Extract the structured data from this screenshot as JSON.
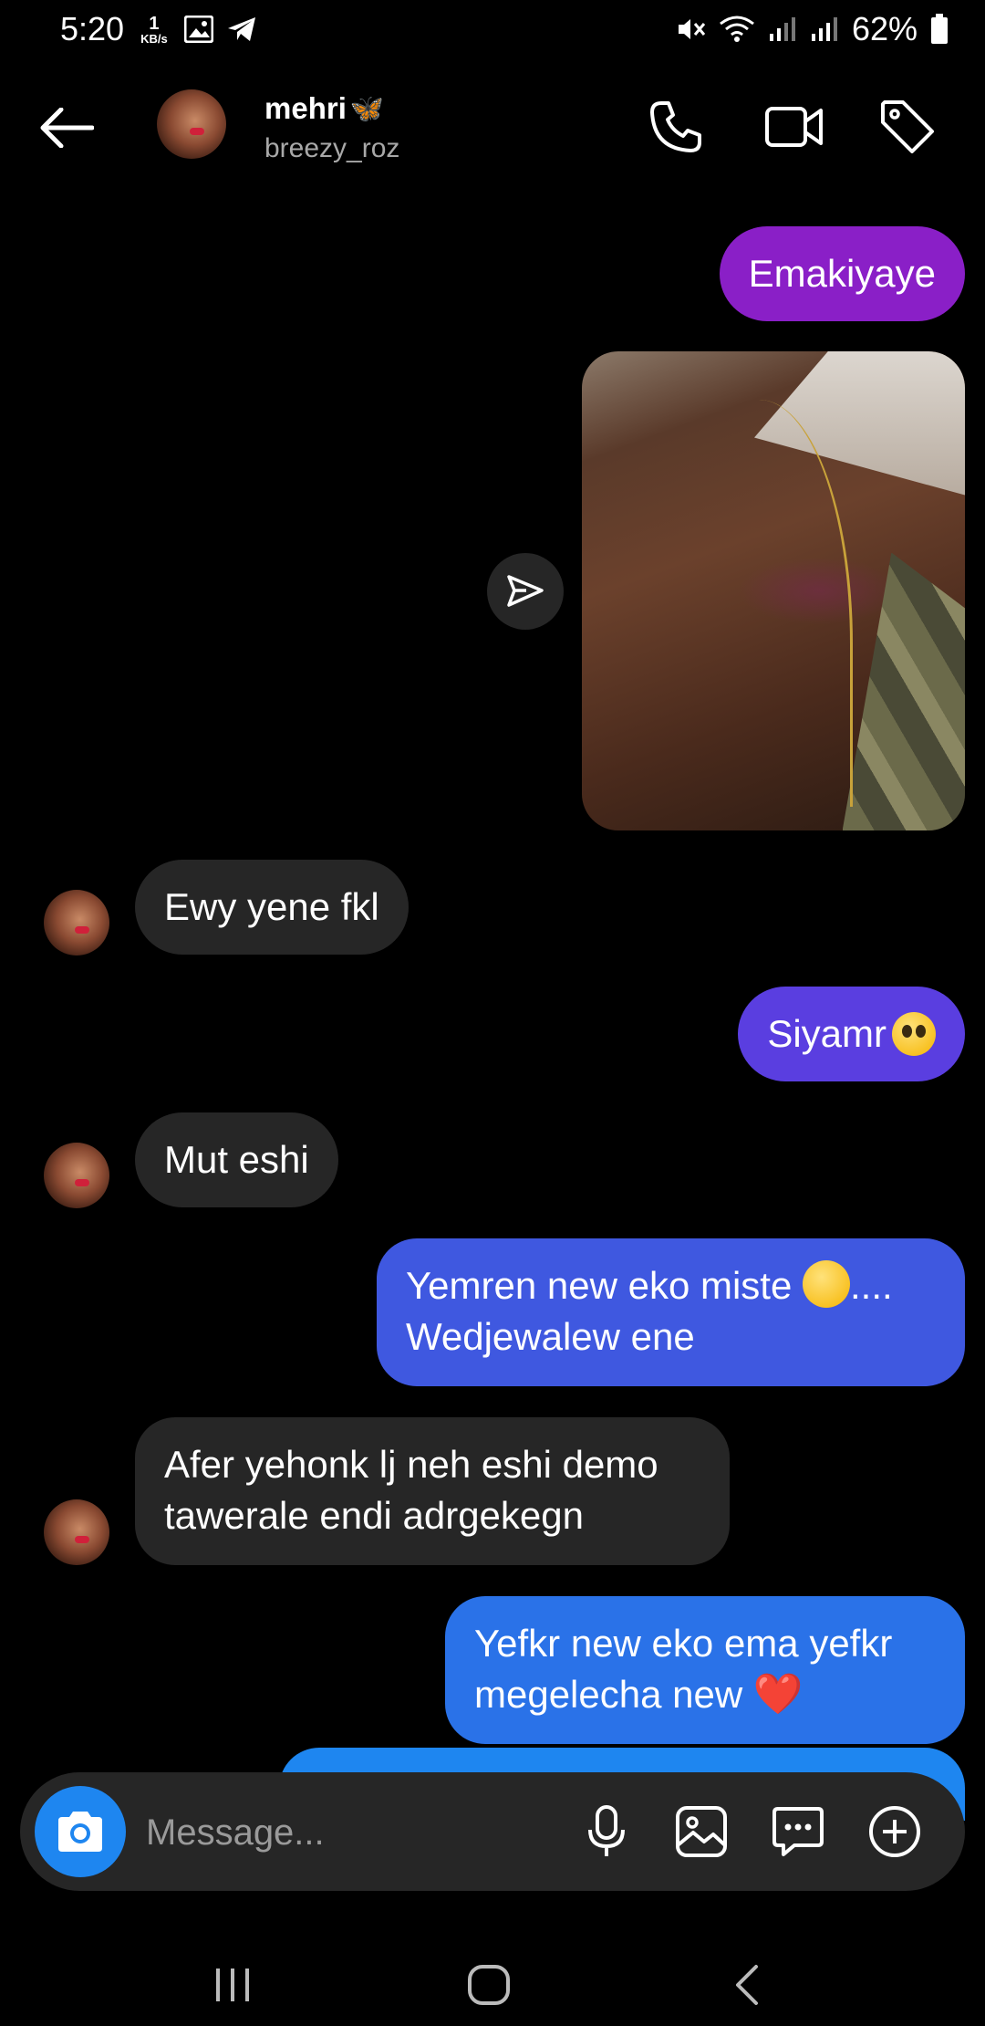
{
  "status_bar": {
    "time": "5:20",
    "data_rate_value": "1",
    "data_rate_unit": "KB/s",
    "battery": "62%"
  },
  "header": {
    "name": "mehri",
    "name_emoji": "🦋",
    "handle": "breezy_roz"
  },
  "messages": [
    {
      "from": "me",
      "text": "Emakiyaye",
      "color": "#8a1fc7"
    },
    {
      "from": "me",
      "type": "photo"
    },
    {
      "from": "them",
      "text": "Ewy yene fkl"
    },
    {
      "from": "me",
      "text": "Siyamr",
      "emoji": "pleading-face",
      "color": "#5a3ee0"
    },
    {
      "from": "them",
      "text": "Mut eshi"
    },
    {
      "from": "me",
      "line1": "Yemren new eko miste",
      "line1_suffix": "....",
      "line2": "Wedjewalew ene",
      "emoji": "hugging-face",
      "color": "#3f58e0"
    },
    {
      "from": "them",
      "line1": "Afer yehonk lj neh eshi demo",
      "line2": "tawerale endi adrgekegn"
    },
    {
      "from": "me",
      "line1": "Yefkr new eko ema yefkr",
      "line2": "megelecha new",
      "emoji": "❤️",
      "color": "#2a72e8"
    }
  ],
  "composer": {
    "placeholder": "Message..."
  },
  "colors": {
    "background": "#000000",
    "incoming_bubble": "#262626",
    "accent_blue": "#1e86f0"
  },
  "icons": [
    "back-arrow-icon",
    "phone-icon",
    "video-camera-icon",
    "tag-icon",
    "share-icon",
    "camera-icon",
    "microphone-icon",
    "gallery-icon",
    "sticker-icon",
    "plus-icon"
  ]
}
